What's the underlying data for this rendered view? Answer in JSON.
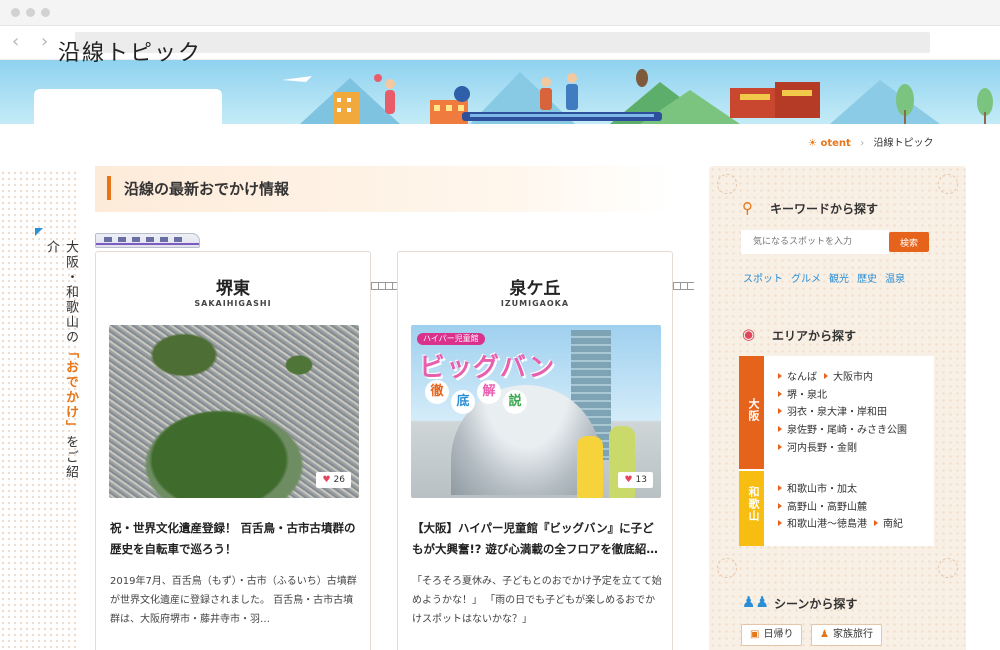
{
  "header": {
    "title": "沿線トピック"
  },
  "breadcrumb": {
    "home": "otent",
    "current": "沿線トピック"
  },
  "side_caption": {
    "pre": "大阪・和歌山の",
    "highlight": "「おでかけ」",
    "post": "をご紹介"
  },
  "section": {
    "title": "沿線の最新おでかけ情報"
  },
  "cards": [
    {
      "name": "堺東",
      "roman": "SAKAIHIGASHI",
      "likes": "26",
      "title": "祝・世界文化遺産登録！ 百舌鳥・古市古墳群の歴史を自転車で巡ろう！",
      "desc": "2019年7月、百舌鳥（もず）・古市（ふるいち）古墳群が世界文化遺産に登録されました。 百舌鳥・古市古墳群は、大阪府堺市・藤井寺市・羽…"
    },
    {
      "name": "泉ケ丘",
      "roman": "IZUMIGAOKA",
      "likes": "13",
      "photo_label": "ハイパー児童館",
      "photo_big": "ビッグバン",
      "photo_keywords": [
        "徹",
        "底",
        "解",
        "説"
      ],
      "title": "【大阪】ハイパー児童館『ビッグバン』に子どもが大興奮!? 遊び心満載の全フロアを徹底紹…",
      "desc": "「そろそろ夏休み、子どもとのおでかけ予定を立てて始めようかな！」 「雨の日でも子どもが楽しめるおでかけスポットはないかな？」"
    }
  ],
  "sidebar": {
    "keyword": {
      "title": "キーワードから探す",
      "placeholder": "気になるスポットを入力",
      "button": "検索",
      "tags": [
        "スポット",
        "グルメ",
        "観光",
        "歴史",
        "温泉"
      ]
    },
    "area": {
      "title": "エリアから探す",
      "osaka_label": "大阪",
      "wakayama_label": "和歌山",
      "osaka": [
        "なんば",
        "大阪市内",
        "堺・泉北",
        "羽衣・泉大津・岸和田",
        "泉佐野・尾崎・みさき公園",
        "河内長野・金剛"
      ],
      "wakayama": [
        "和歌山市・加太",
        "高野山・高野山麓",
        "和歌山港〜徳島港",
        "南紀"
      ]
    },
    "scene": {
      "title": "シーンから探す",
      "buttons": [
        "日帰り",
        "家族旅行"
      ]
    }
  },
  "colors": {
    "accent": "#e6761a",
    "osaka": "#e6631b",
    "wakayama": "#f7bd10",
    "link": "#2b8fd6"
  }
}
